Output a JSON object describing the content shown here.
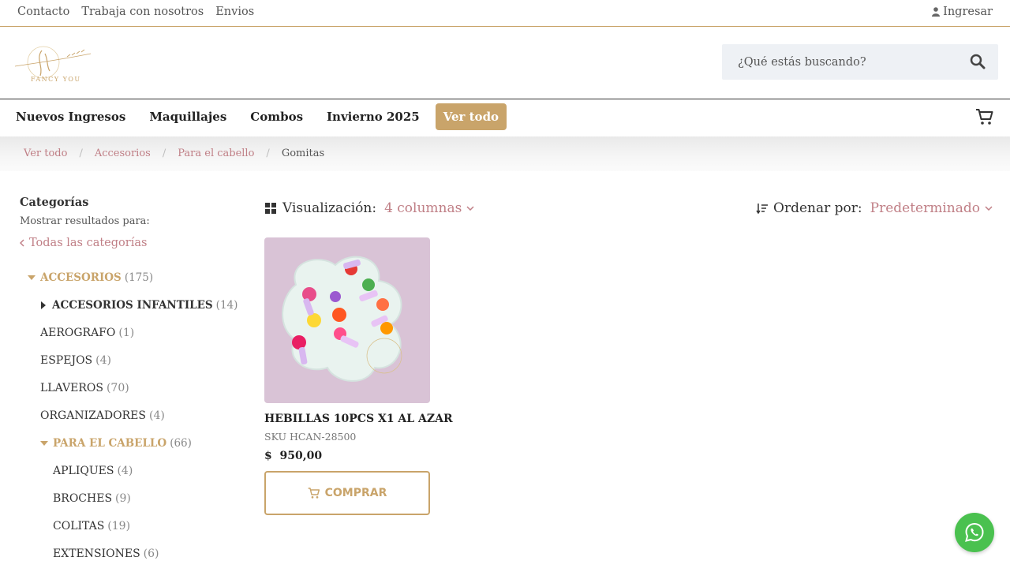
{
  "topbar": {
    "links": [
      "Contacto",
      "Trabaja con nosotros",
      "Envios"
    ],
    "login": "Ingresar"
  },
  "header": {
    "logo_text": "FANCY YOU",
    "search_placeholder": "¿Qué estás buscando?"
  },
  "nav": {
    "items": [
      "Nuevos Ingresos",
      "Maquillajes",
      "Combos",
      "Invierno 2025"
    ],
    "active_item": "Ver todo"
  },
  "breadcrumb": {
    "items": [
      "Ver todo",
      "Accesorios",
      "Para el cabello"
    ],
    "current": "Gomitas"
  },
  "sidebar": {
    "title": "Categorías",
    "subtitle": "Mostrar resultados para:",
    "all_link": "Todas las categorías",
    "categories": [
      {
        "label": "ACCESORIOS",
        "count": "(175)"
      },
      {
        "label": "ACCESORIOS INFANTILES",
        "count": "(14)"
      },
      {
        "label": "AEROGRAFO",
        "count": "(1)"
      },
      {
        "label": "ESPEJOS",
        "count": "(4)"
      },
      {
        "label": "LLAVEROS",
        "count": "(70)"
      },
      {
        "label": "ORGANIZADORES",
        "count": "(4)"
      },
      {
        "label": "PARA EL CABELLO",
        "count": "(66)"
      },
      {
        "label": "APLIQUES",
        "count": "(4)"
      },
      {
        "label": "BROCHES",
        "count": "(9)"
      },
      {
        "label": "COLITAS",
        "count": "(19)"
      },
      {
        "label": "EXTENSIONES",
        "count": "(6)"
      }
    ]
  },
  "toolbar": {
    "view_label": "Visualización:",
    "view_value": "4 columnas",
    "sort_label": "Ordenar por:",
    "sort_value": "Predeterminado"
  },
  "product": {
    "name": "HEBILLAS 10PCS X1 AL AZAR",
    "sku": "SKU HCAN-28500",
    "price": "$  950,00",
    "buy_label": "COMPRAR"
  },
  "colors": {
    "accent": "#c9a46a",
    "link": "#c07f86",
    "whatsapp": "#4ac14f"
  }
}
